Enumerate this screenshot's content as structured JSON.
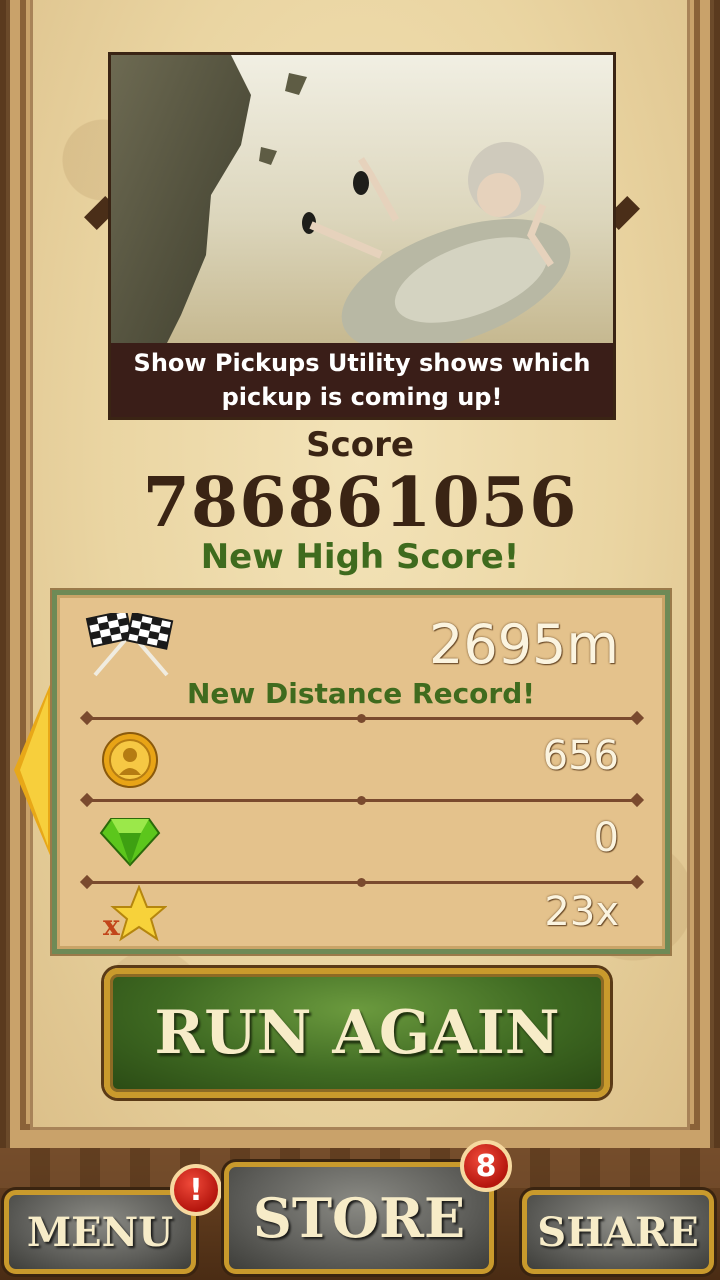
{
  "video": {
    "caption": "Show Pickups Utility shows which pickup is coming up!"
  },
  "score": {
    "label": "Score",
    "value": "786861056",
    "high_score_text": "New High Score!"
  },
  "stats": {
    "distance": "2695m",
    "distance_record_text": "New Distance Record!",
    "coins": "656",
    "gems": "0",
    "multiplier": "23x",
    "multiplier_icon_letter": "x"
  },
  "buttons": {
    "run_again": "RUN AGAIN",
    "menu": "MENU",
    "store": "STORE",
    "share": "SHARE"
  },
  "badges": {
    "menu": "!",
    "store": "8"
  },
  "icons": {
    "distance": "checkered-flags-icon",
    "coins": "coin-icon",
    "gems": "green-gem-icon",
    "multiplier": "star-multiplier-icon",
    "back": "back-arrow-icon"
  },
  "colors": {
    "accent_green": "#3f6b1e",
    "score_brown": "#3a2414",
    "button_gold": "#c99a2c"
  }
}
